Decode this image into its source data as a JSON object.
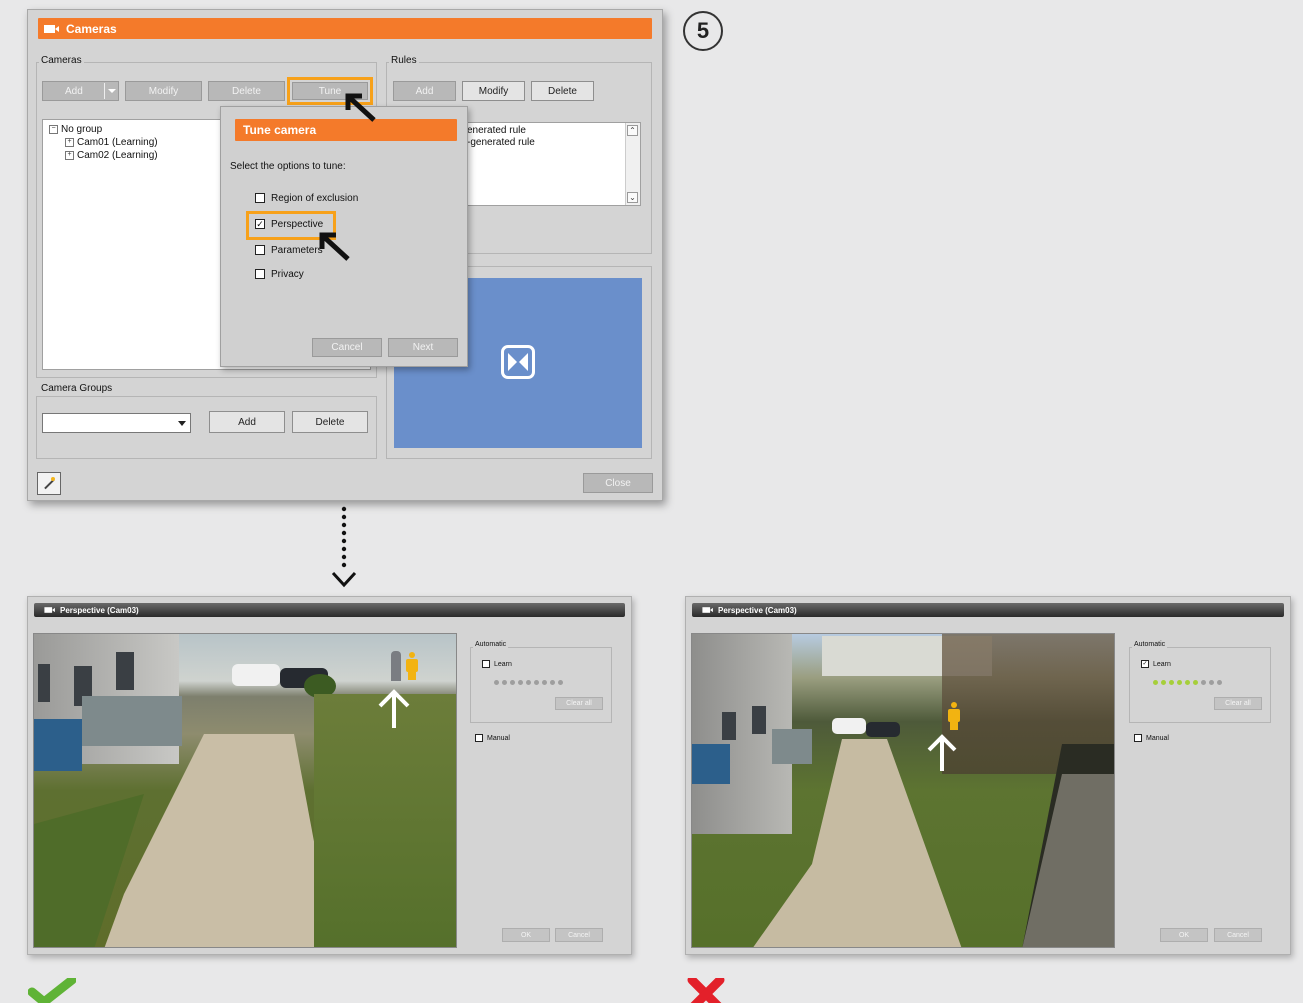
{
  "step_number": "5",
  "cameras_window": {
    "title": "Cameras",
    "cameras_group_label": "Cameras",
    "toolbar": {
      "add": "Add",
      "modify": "Modify",
      "delete": "Delete",
      "tune": "Tune"
    },
    "tree": {
      "root": "No group",
      "items": [
        "Cam01 (Learning)",
        "Cam02 (Learning)"
      ]
    },
    "rules_group_label": "Rules",
    "rules_toolbar": {
      "add": "Add",
      "modify": "Modify",
      "delete": "Delete"
    },
    "rules_items": [
      "enerated rule",
      "-generated rule"
    ],
    "camera_groups_label": "Camera Groups",
    "camera_groups_select_value": "",
    "camera_groups_add": "Add",
    "camera_groups_delete": "Delete",
    "close": "Close"
  },
  "tune_dialog": {
    "title": "Tune camera",
    "prompt": "Select the options to tune:",
    "options": [
      {
        "label": "Region of exclusion",
        "checked": false
      },
      {
        "label": "Perspective",
        "checked": true
      },
      {
        "label": "Parameters",
        "checked": false
      },
      {
        "label": "Privacy",
        "checked": false
      }
    ],
    "cancel": "Cancel",
    "next": "Next"
  },
  "perspective_left": {
    "title": "Perspective (Cam03)",
    "automatic_label": "Automatic",
    "learn_label": "Learn",
    "learn_checked": false,
    "progress_dots_filled": 0,
    "progress_dots_total": 9,
    "clear_all": "Clear all",
    "manual_label": "Manual",
    "ok": "OK",
    "cancel": "Cancel",
    "verdict": "correct"
  },
  "perspective_right": {
    "title": "Perspective (Cam03)",
    "automatic_label": "Automatic",
    "learn_label": "Learn",
    "learn_checked": true,
    "progress_dots_filled": 6,
    "progress_dots_total": 9,
    "clear_all": "Clear all",
    "manual_label": "Manual",
    "ok": "OK",
    "cancel": "Cancel",
    "verdict": "incorrect"
  },
  "colors": {
    "accent_orange": "#f47a2a",
    "highlight": "#f7a11a",
    "preview_blue": "#6a8fcb",
    "dot_green": "#a6cf3a",
    "dot_gray": "#9e9e9e",
    "check_green": "#5fb336",
    "cross_red": "#e3202a"
  }
}
